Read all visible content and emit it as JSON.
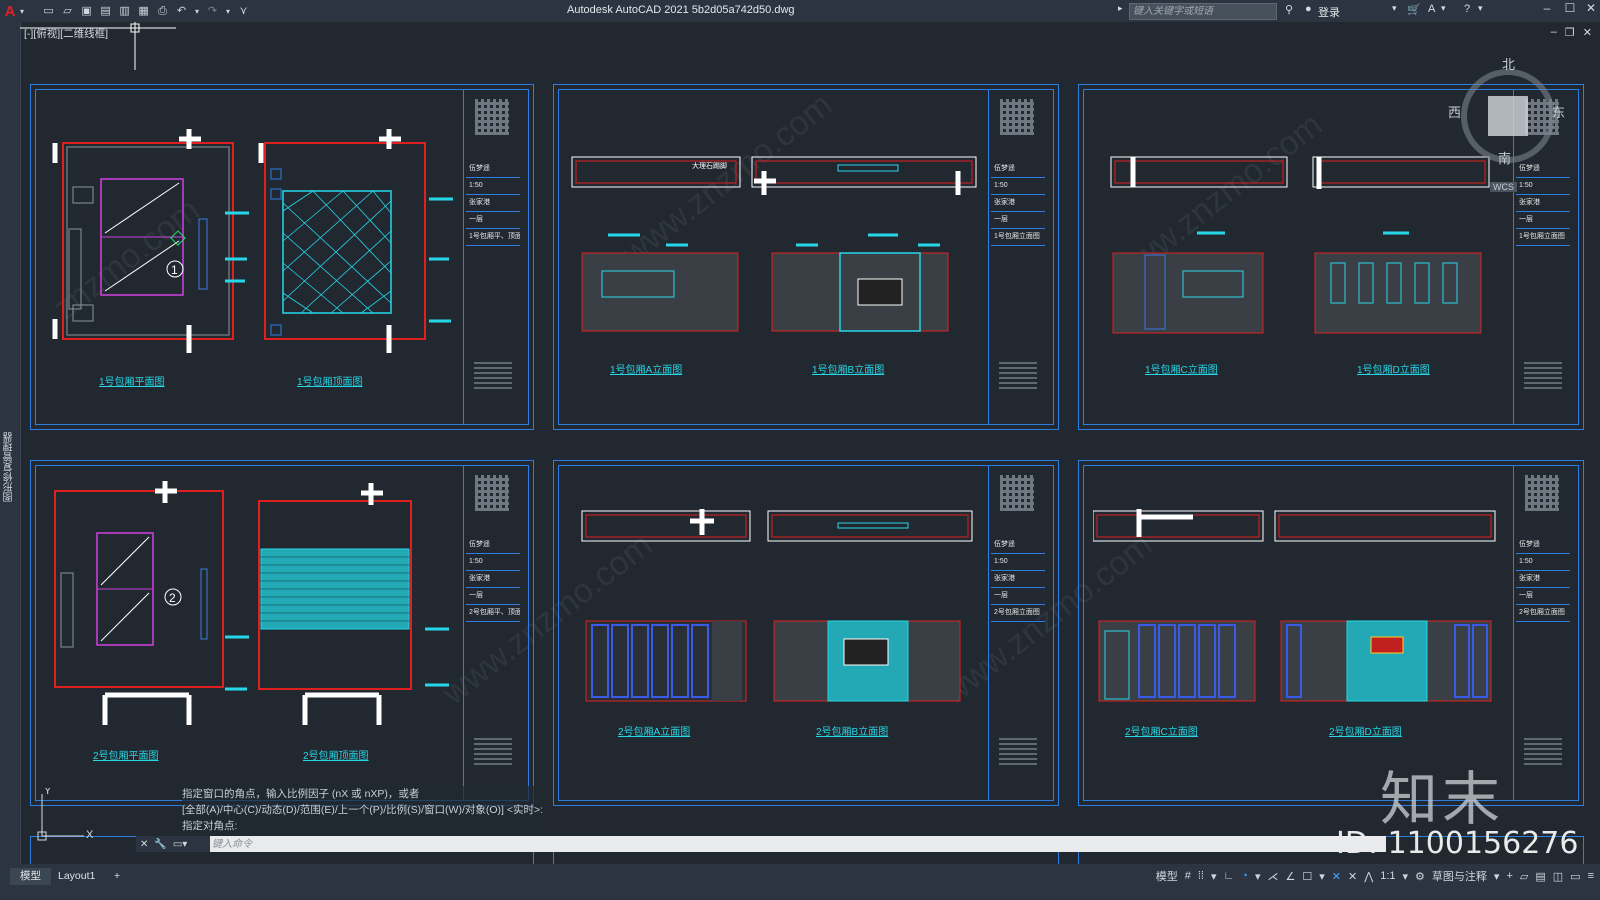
{
  "titlebar": {
    "app_title": "Autodesk AutoCAD 2021      5b2d05a742d50.dwg",
    "search_placeholder": "键入关键字或短语",
    "login_label": "登录"
  },
  "viewport": {
    "label": "[-][俯视][二维线框]"
  },
  "left_palette": {
    "label": "图形修复管理器"
  },
  "navcube": {
    "north": "北",
    "south": "南",
    "east": "东",
    "west": "西",
    "ucs": "WCS"
  },
  "sheets": [
    {
      "views": [
        "1号包厢平面图",
        "1号包厢顶面图"
      ],
      "title_rows": [
        "伍梦遥",
        "1:50",
        "张家港",
        "一层",
        "1号包厢平、顶面图"
      ]
    },
    {
      "views": [
        "1号包厢A立面图",
        "1号包厢B立面图"
      ],
      "title_rows": [
        "伍梦遥",
        "1:50",
        "张家港",
        "一层",
        "1号包厢立面图"
      ]
    },
    {
      "views": [
        "1号包厢C立面图",
        "1号包厢D立面图"
      ],
      "title_rows": [
        "伍梦遥",
        "1:50",
        "张家港",
        "一层",
        "1号包厢立面图"
      ]
    },
    {
      "views": [
        "2号包厢平面图",
        "2号包厢顶面图"
      ],
      "title_rows": [
        "伍梦遥",
        "1:50",
        "张家港",
        "一层",
        "2号包厢平、顶面图"
      ]
    },
    {
      "views": [
        "2号包厢A立面图",
        "2号包厢B立面图"
      ],
      "title_rows": [
        "伍梦遥",
        "1:50",
        "张家港",
        "一层",
        "2号包厢立面图"
      ]
    },
    {
      "views": [
        "2号包厢C立面图",
        "2号包厢D立面图"
      ],
      "title_rows": [
        "伍梦遥",
        "1:50",
        "张家港",
        "一层",
        "2号包厢立面图"
      ]
    }
  ],
  "drawing_notes": {
    "marble": "大理石踢脚",
    "room1": "1",
    "room2": "2"
  },
  "command": {
    "history": [
      "指定窗口的角点，输入比例因子 (nX 或 nXP)，或者",
      "[全部(A)/中心(C)/动态(D)/范围(E)/上一个(P)/比例(S)/窗口(W)/对象(O)] <实时>:",
      "指定对角点:"
    ],
    "placeholder": "键入命令"
  },
  "layout_tabs": [
    "模型",
    "Layout1",
    "+"
  ],
  "statusbar": {
    "model": "模型",
    "scale": "1:1",
    "annotation": "草图与注释"
  },
  "watermark": {
    "logo": "知末",
    "id": "ID: 1100156276"
  }
}
